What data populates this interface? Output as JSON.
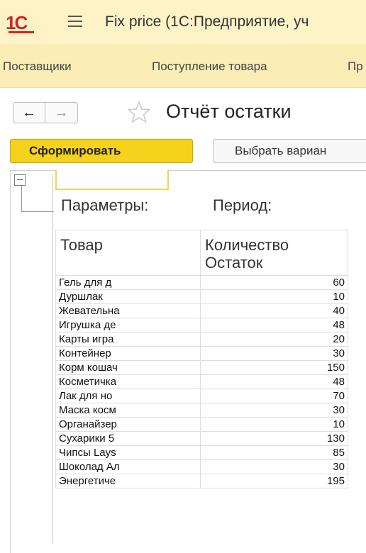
{
  "titlebar": {
    "logo": "1С",
    "title": "Fix price  (1С:Предприятие, уч"
  },
  "sections": {
    "items": [
      "Поставщики",
      "Поступление товара",
      "Пр"
    ]
  },
  "form": {
    "title": "Отчёт остатки",
    "nav_back": "←",
    "nav_forward": "→"
  },
  "commands": {
    "generate_label": "Сформировать",
    "variant_label": "Выбрать вариан"
  },
  "report": {
    "parameters_label": "Параметры:",
    "period_label": "Период:",
    "columns": {
      "product": "Товар",
      "quantity_line1": "Количество",
      "quantity_line2": "Остаток"
    },
    "rows": [
      {
        "name": "Гель для д",
        "qty": "60"
      },
      {
        "name": "Дуршлак",
        "qty": "10"
      },
      {
        "name": "Жевательна",
        "qty": "40"
      },
      {
        "name": "Игрушка де",
        "qty": "48"
      },
      {
        "name": "Карты игра",
        "qty": "20"
      },
      {
        "name": "Контейнер",
        "qty": "30"
      },
      {
        "name": "Корм кошач",
        "qty": "150"
      },
      {
        "name": "Косметичка",
        "qty": "48"
      },
      {
        "name": "Лак для но",
        "qty": "70"
      },
      {
        "name": "Маска косм",
        "qty": "30"
      },
      {
        "name": "Органайзер",
        "qty": "10"
      },
      {
        "name": "Сухарики 5",
        "qty": "130"
      },
      {
        "name": "Чипсы Lays",
        "qty": "85"
      },
      {
        "name": "Шоколад Ал",
        "qty": "30"
      },
      {
        "name": "Энергетиче",
        "qty": "195"
      }
    ]
  },
  "colors": {
    "titlebar_bg": "#fdf3c7",
    "sections_bg": "#fbedb6",
    "accent_button": "#f5d21c",
    "logo_red": "#d0232c"
  },
  "icons": [
    "logo-1c-icon",
    "menu-icon",
    "arrow-left-icon",
    "arrow-right-icon",
    "star-icon",
    "collapse-minus-icon"
  ]
}
